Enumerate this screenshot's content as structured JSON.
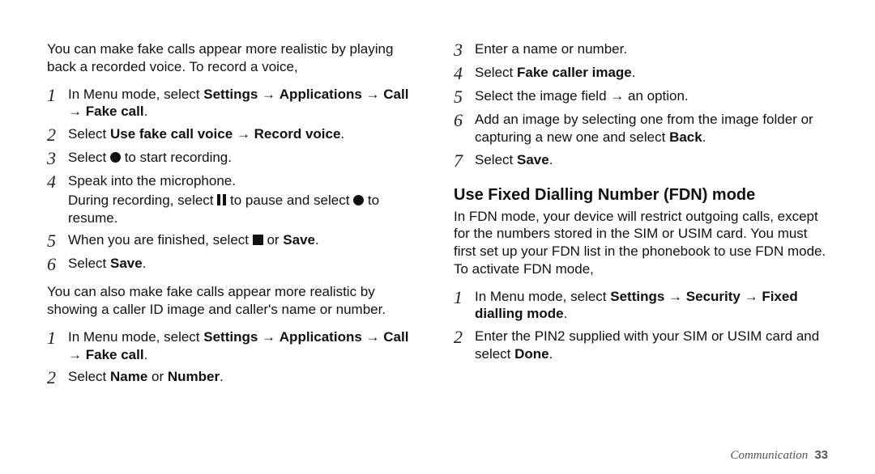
{
  "left": {
    "introA": "You can make fake calls appear more realistic by playing back a recorded voice. To record a voice,",
    "stepsA": [
      {
        "n": "1",
        "segments": [
          {
            "t": "In Menu mode, select "
          },
          {
            "t": "Settings",
            "b": true
          },
          {
            "t": " → "
          },
          {
            "t": "Applications",
            "b": true
          },
          {
            "t": " → "
          },
          {
            "t": "Call",
            "b": true
          },
          {
            "t": " → "
          },
          {
            "t": "Fake call",
            "b": true
          },
          {
            "t": "."
          }
        ]
      },
      {
        "n": "2",
        "segments": [
          {
            "t": "Select "
          },
          {
            "t": "Use fake call voice",
            "b": true
          },
          {
            "t": " → "
          },
          {
            "t": "Record voice",
            "b": true
          },
          {
            "t": "."
          }
        ]
      },
      {
        "n": "3",
        "segments": [
          {
            "t": "Select "
          },
          {
            "icon": "circle",
            "name": "record-icon"
          },
          {
            "t": " to start recording."
          }
        ]
      },
      {
        "n": "4",
        "segments": [
          {
            "t": "Speak into the microphone."
          }
        ],
        "extra": [
          {
            "t": "During recording, select "
          },
          {
            "icon": "pause",
            "name": "pause-icon"
          },
          {
            "t": " to pause and select "
          },
          {
            "icon": "circle",
            "name": "record-icon"
          },
          {
            "t": " to resume."
          }
        ]
      },
      {
        "n": "5",
        "segments": [
          {
            "t": "When you are finished, select "
          },
          {
            "icon": "stop",
            "name": "stop-icon"
          },
          {
            "t": " or "
          },
          {
            "t": "Save",
            "b": true
          },
          {
            "t": "."
          }
        ]
      },
      {
        "n": "6",
        "segments": [
          {
            "t": "Select "
          },
          {
            "t": "Save",
            "b": true
          },
          {
            "t": "."
          }
        ]
      }
    ],
    "introB": "You can also make fake calls appear more realistic by showing a caller ID image and caller's name or number.",
    "stepsB": [
      {
        "n": "1",
        "segments": [
          {
            "t": "In Menu mode, select "
          },
          {
            "t": "Settings",
            "b": true
          },
          {
            "t": " → "
          },
          {
            "t": "Applications",
            "b": true
          },
          {
            "t": " → "
          },
          {
            "t": "Call",
            "b": true
          },
          {
            "t": " → "
          },
          {
            "t": "Fake call",
            "b": true
          },
          {
            "t": "."
          }
        ]
      },
      {
        "n": "2",
        "segments": [
          {
            "t": "Select "
          },
          {
            "t": "Name",
            "b": true
          },
          {
            "t": " or "
          },
          {
            "t": "Number",
            "b": true
          },
          {
            "t": "."
          }
        ]
      }
    ]
  },
  "right": {
    "stepsA": [
      {
        "n": "3",
        "segments": [
          {
            "t": "Enter a name or number."
          }
        ]
      },
      {
        "n": "4",
        "segments": [
          {
            "t": "Select "
          },
          {
            "t": "Fake caller image",
            "b": true
          },
          {
            "t": "."
          }
        ]
      },
      {
        "n": "5",
        "segments": [
          {
            "t": "Select the image field → an option."
          }
        ]
      },
      {
        "n": "6",
        "segments": [
          {
            "t": "Add an image by selecting one from the image folder or capturing a new one and select "
          },
          {
            "t": "Back",
            "b": true
          },
          {
            "t": "."
          }
        ]
      },
      {
        "n": "7",
        "segments": [
          {
            "t": "Select "
          },
          {
            "t": "Save",
            "b": true
          },
          {
            "t": "."
          }
        ]
      }
    ],
    "heading": "Use Fixed Dialling Number (FDN) mode",
    "introB": "In FDN mode, your device will restrict outgoing calls, except for the numbers stored in the SIM or USIM card. You must first set up your FDN list in the phonebook to use FDN mode. To activate FDN mode,",
    "stepsB": [
      {
        "n": "1",
        "segments": [
          {
            "t": "In Menu mode, select "
          },
          {
            "t": "Settings",
            "b": true
          },
          {
            "t": " → "
          },
          {
            "t": "Security",
            "b": true
          },
          {
            "t": " → "
          },
          {
            "t": "Fixed dialling mode",
            "b": true
          },
          {
            "t": "."
          }
        ]
      },
      {
        "n": "2",
        "segments": [
          {
            "t": "Enter the PIN2 supplied with your SIM or USIM card and select "
          },
          {
            "t": "Done",
            "b": true
          },
          {
            "t": "."
          }
        ]
      }
    ]
  },
  "footer": {
    "section": "Communication",
    "page": "33"
  }
}
